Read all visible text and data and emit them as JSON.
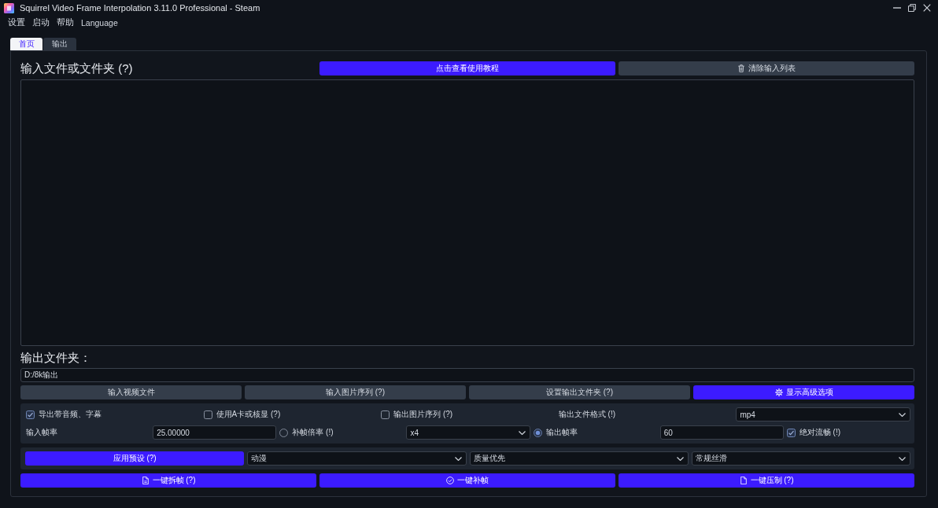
{
  "window": {
    "title": "Squirrel Video Frame Interpolation 3.11.0 Professional - Steam"
  },
  "menu": [
    "设置",
    "启动",
    "帮助",
    "Language"
  ],
  "tabs": [
    {
      "label": "首页",
      "selected": true
    },
    {
      "label": "输出",
      "selected": false
    }
  ],
  "input_section": {
    "heading": "输入文件或文件夹 (?)",
    "buttons": [
      {
        "label": "点击查看使用教程",
        "kind": "primary"
      },
      {
        "label": "清除输入列表",
        "kind": "secondary"
      }
    ]
  },
  "output_section": {
    "heading": "输出文件夹：",
    "folder_field": {
      "value": "D:/8k输出"
    },
    "buttons": [
      {
        "label": "输入视频文件",
        "kind": "secondary"
      },
      {
        "label": "输入图片序列 (?)",
        "kind": "secondary"
      },
      {
        "label": "设置输出文件夹 (?)",
        "kind": "secondary"
      },
      {
        "label": "显示高级选项",
        "kind": "primary"
      }
    ]
  },
  "options": {
    "row_1": [
      {
        "kind": "checkbox",
        "label": "导出带音频、字幕",
        "checked": true
      },
      {
        "kind": "checkbox",
        "label": "使用A卡或核显 (?)",
        "checked": false
      },
      {
        "kind": "checkbox",
        "label": "输出图片序列 (?)",
        "checked": false
      },
      {
        "kind": "label",
        "label": "输出文件格式 (!)"
      },
      {
        "kind": "select",
        "value": "mp4"
      }
    ],
    "row_2": [
      {
        "kind": "label",
        "label": "输入帧率"
      },
      {
        "kind": "input",
        "value": "25.00000"
      },
      {
        "kind": "radio",
        "label": "补帧倍率 (!)",
        "selected": false
      },
      {
        "kind": "select",
        "value": "x4"
      },
      {
        "kind": "radio",
        "label": "输出帧率",
        "selected": true
      },
      {
        "kind": "input",
        "value": "60"
      },
      {
        "kind": "checkbox",
        "label": "绝对流畅 (!)",
        "checked": true
      }
    ]
  },
  "presets": {
    "button": {
      "label": "应用预设 (?)"
    },
    "selects": [
      {
        "value": "动漫"
      },
      {
        "value": "质量优先"
      },
      {
        "value": "常规丝滑"
      }
    ]
  },
  "actions": [
    {
      "label": "一键拆帧 (?)"
    },
    {
      "label": "一键补帧"
    },
    {
      "label": "一键压制 (?)"
    }
  ]
}
